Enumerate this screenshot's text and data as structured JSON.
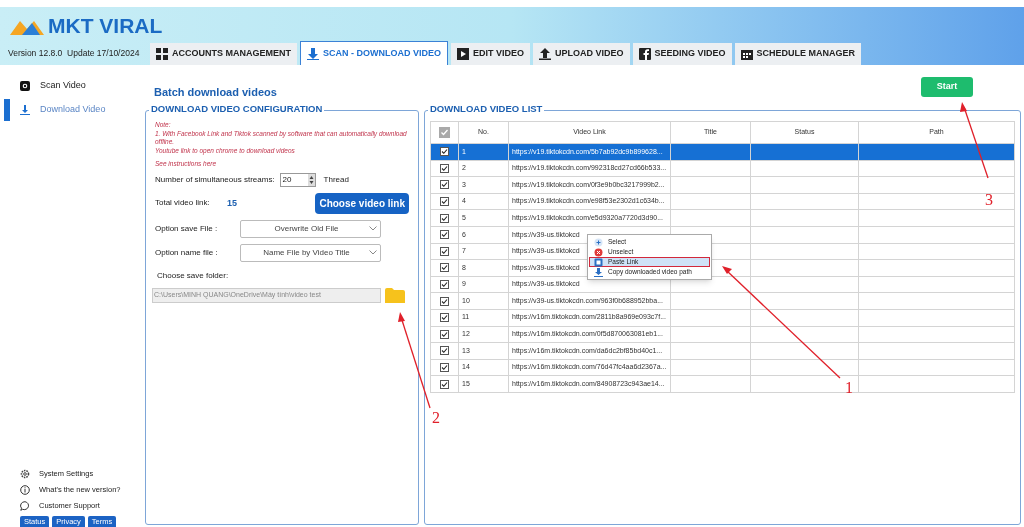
{
  "app": {
    "logo": "MKT VIRAL",
    "version": "Version 12.8.0  Update 17/10/2024"
  },
  "tabs": [
    {
      "label": "ACCOUNTS MANAGEMENT",
      "selected": false,
      "kind": "grid"
    },
    {
      "label": "SCAN - DOWNLOAD VIDEO",
      "selected": true,
      "kind": "download"
    },
    {
      "label": "EDIT VIDEO",
      "selected": false,
      "kind": "film"
    },
    {
      "label": "UPLOAD VIDEO",
      "selected": false,
      "kind": "upload"
    },
    {
      "label": "SEEDING VIDEO",
      "selected": false,
      "kind": "facebook"
    },
    {
      "label": "SCHEDULE MANAGER",
      "selected": false,
      "kind": "calendar"
    }
  ],
  "sidebar": {
    "items": [
      {
        "label": "Scan Video",
        "selected": false,
        "kind": "camera"
      },
      {
        "label": "Download Video",
        "selected": true,
        "kind": "download"
      }
    ],
    "footer_items": [
      {
        "label": "System Settings",
        "kind": "gear"
      },
      {
        "label": "What's the new version?",
        "kind": "info"
      },
      {
        "label": "Customer Support",
        "kind": "chat"
      }
    ],
    "footer_buttons": [
      "Status",
      "Privacy",
      "Terms"
    ]
  },
  "page_title": "Batch download videos",
  "start_button": "Start",
  "config": {
    "title": "DOWNLOAD VIDEO CONFIGURATION",
    "note": [
      "Note:",
      "1. With Facebook Link and Tiktok scanned by software that can automatically download offline.",
      "Youtube link to open chrome to download videos"
    ],
    "instructions_link": "See instructions here",
    "streams_label": "Number of simultaneous streams:",
    "streams_value": "20",
    "streams_unit": "Thread",
    "total_label": "Total video link:",
    "total_value": "15",
    "choose_button": "Choose video link",
    "save_label": "Option save File :",
    "save_value": "Overwrite Old File",
    "name_label": "Option name file :",
    "name_value": "Name File by Video Title",
    "folder_label": "Choose save folder:",
    "folder_value": "C:\\Users\\MINH QUANG\\OneDrive\\Máy tính\\video test"
  },
  "list": {
    "title": "DOWNLOAD VIDEO LIST",
    "header_checked": true,
    "columns": [
      "No.",
      "Video Link",
      "Title",
      "Status",
      "Path"
    ],
    "rows": [
      {
        "no": "1",
        "link": "https://v19.tiktokcdn.com/5b7ab92dc9b899628...",
        "checked": true,
        "selected": true
      },
      {
        "no": "2",
        "link": "https://v19.tiktokcdn.com/992318cd27cd66b533...",
        "checked": true,
        "selected": false
      },
      {
        "no": "3",
        "link": "https://v19.tiktokcdn.com/0f3e9b0bc3217999b2...",
        "checked": true,
        "selected": false
      },
      {
        "no": "4",
        "link": "https://v19.tiktokcdn.com/e98f53e2302d1c634b...",
        "checked": true,
        "selected": false
      },
      {
        "no": "5",
        "link": "https://v19.tiktokcdn.com/e5d9320a7720d3d90...",
        "checked": true,
        "selected": false
      },
      {
        "no": "6",
        "link": "https://v39-us.tiktokcd",
        "checked": true,
        "selected": false
      },
      {
        "no": "7",
        "link": "https://v39-us.tiktokcd",
        "checked": true,
        "selected": false
      },
      {
        "no": "8",
        "link": "https://v39-us.tiktokcd",
        "checked": true,
        "selected": false
      },
      {
        "no": "9",
        "link": "https://v39-us.tiktokcd",
        "checked": true,
        "selected": false
      },
      {
        "no": "10",
        "link": "https://v39-us.tiktokcdn.com/963f0b688952bba...",
        "checked": true,
        "selected": false
      },
      {
        "no": "11",
        "link": "https://v16m.tiktokcdn.com/2811b8a969e093c7f...",
        "checked": true,
        "selected": false
      },
      {
        "no": "12",
        "link": "https://v16m.tiktokcdn.com/0f5d870063081eb1...",
        "checked": true,
        "selected": false
      },
      {
        "no": "13",
        "link": "https://v16m.tiktokcdn.com/da6dc2bf85bd40c1...",
        "checked": true,
        "selected": false
      },
      {
        "no": "14",
        "link": "https://v16m.tiktokcdn.com/76d47fc4aa6d2367a...",
        "checked": true,
        "selected": false
      },
      {
        "no": "15",
        "link": "https://v16m.tiktokcdn.com/84908723c943ae14...",
        "checked": true,
        "selected": false
      }
    ]
  },
  "context_menu": [
    {
      "label": "Select",
      "kind": "plus",
      "selected": false
    },
    {
      "label": "Unselect",
      "kind": "cross",
      "selected": false
    },
    {
      "label": "Paste Link",
      "kind": "paste",
      "selected": true
    },
    {
      "label": "Copy downloaded video path",
      "kind": "download",
      "selected": false
    }
  ],
  "annotations": [
    {
      "label": "1"
    },
    {
      "label": "2"
    },
    {
      "label": "3"
    }
  ]
}
